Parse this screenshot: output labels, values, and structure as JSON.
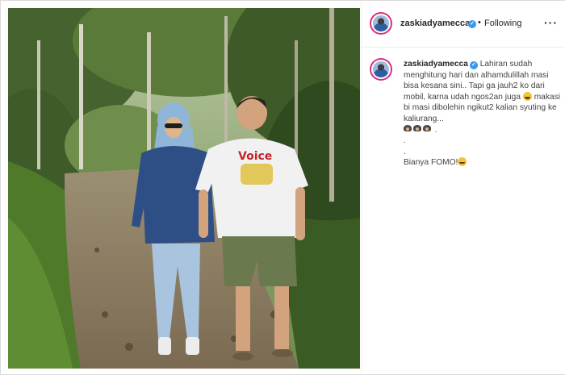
{
  "post": {
    "username": "zaskiadyamecca",
    "verified": true,
    "separator": "•",
    "follow_status": "Following",
    "more_icon": "more-horizontal-icon"
  },
  "caption": {
    "username": "zaskiadyamecca",
    "line1": "Lahiran sudah menghitung hari dan alhamdulillah masi bisa kesana sini.. Tapi ga jauh2 ko dari mobil, karna udah ngos2an juga",
    "line2": "makasi bi masi dibolehin ngikut2 kalian syuting ke kaliurang...",
    "dot1": ".",
    "dot2": ".",
    "dot3": ".",
    "closing": "Bianya FOMO!"
  },
  "photo": {
    "shirt_text": "Voice"
  },
  "colors": {
    "verified": "#3897f0",
    "avatar_ring": "#d92e7f"
  }
}
